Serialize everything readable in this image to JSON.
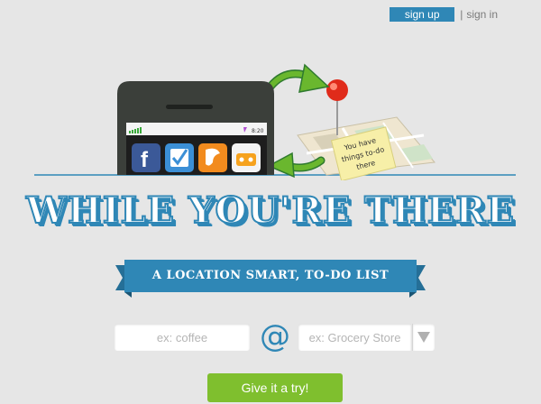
{
  "auth": {
    "signup_label": "sign up",
    "separator": "|",
    "signin_label": "sign in"
  },
  "phone": {
    "time": "8:20"
  },
  "note": {
    "text_lines": [
      "You have",
      "things to-do",
      "there"
    ]
  },
  "hero": {
    "title": "WHILE YOU'RE THERE",
    "tagline": "A LOCATION SMART, TO-DO LIST"
  },
  "form": {
    "what_placeholder": "ex: coffee",
    "at_symbol": "@",
    "where_placeholder": "ex: Grocery Store",
    "submit_label": "Give it a try!"
  },
  "colors": {
    "brand_blue": "#2f87b6",
    "action_green": "#7fbf2e",
    "background": "#e6e6e6",
    "phone_body": "#3b3f3a",
    "pin_red": "#e02b1a"
  }
}
